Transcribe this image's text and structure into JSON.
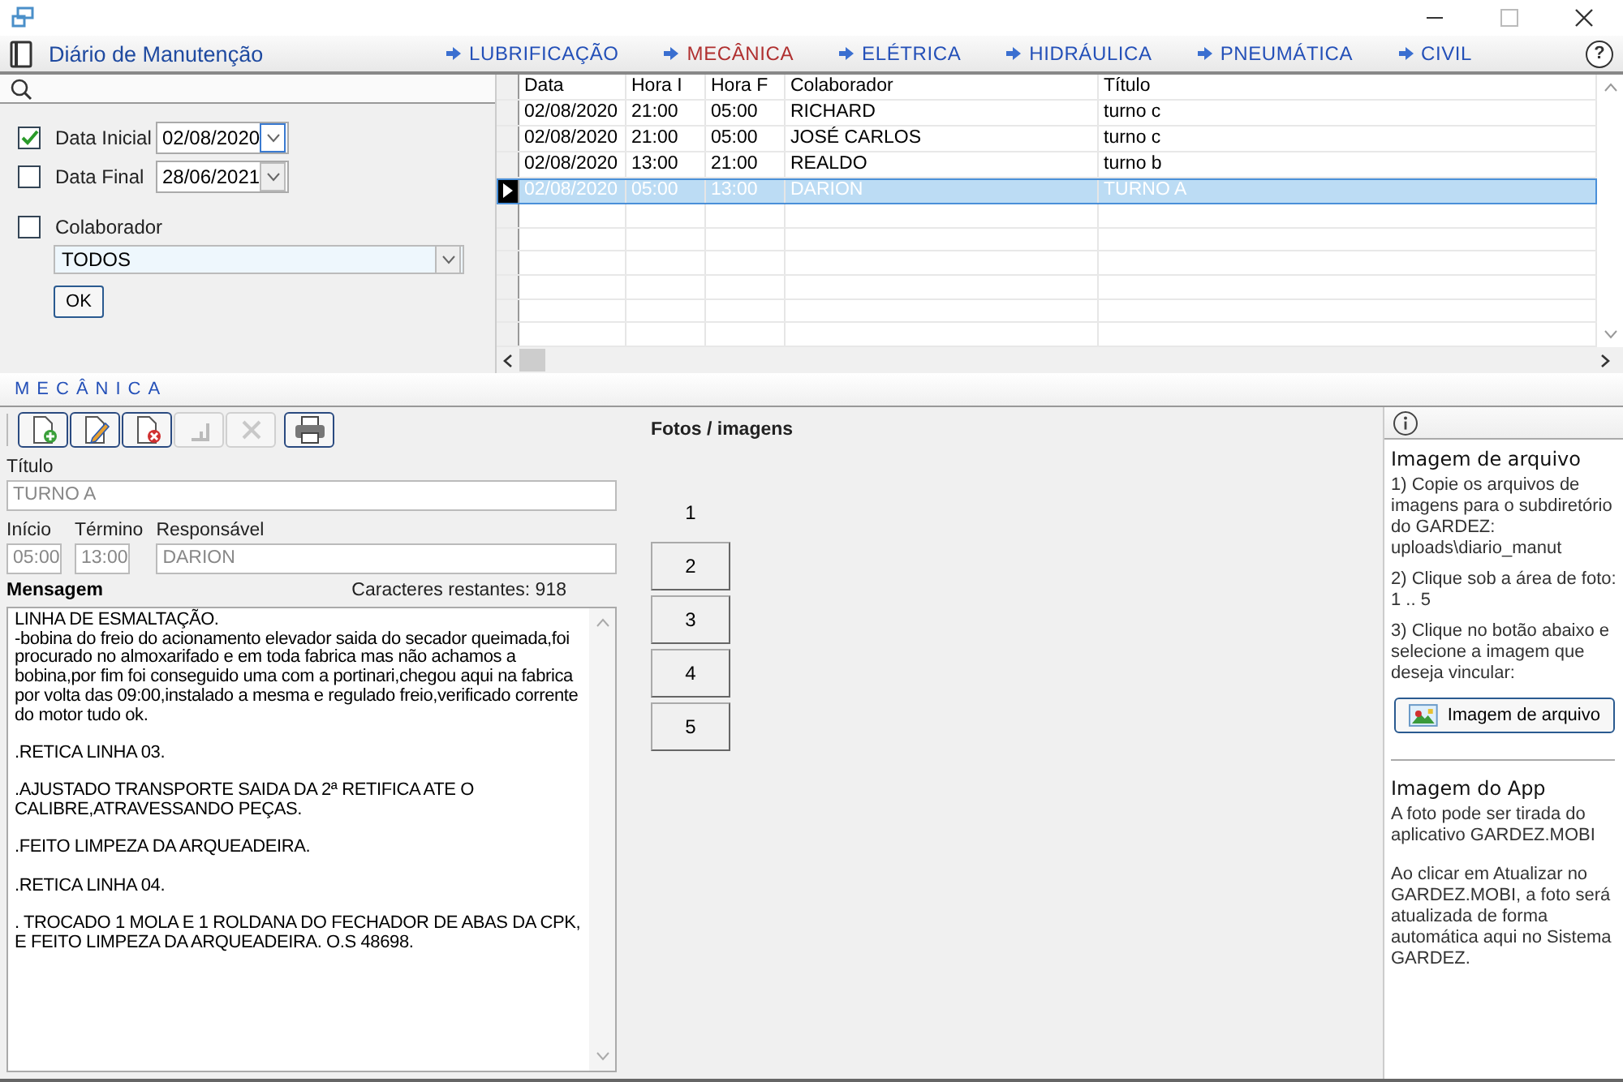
{
  "header": {
    "title": "Diário de Manutenção",
    "help": "?"
  },
  "nav": [
    {
      "label": "LUBRIFICAÇÃO",
      "selected": false
    },
    {
      "label": "MECÂNICA",
      "selected": true
    },
    {
      "label": "ELÉTRICA",
      "selected": false
    },
    {
      "label": "HIDRÁULICA",
      "selected": false
    },
    {
      "label": "PNEUMÁTICA",
      "selected": false
    },
    {
      "label": "CIVIL",
      "selected": false
    }
  ],
  "filters": {
    "start": {
      "label": "Data Inicial",
      "checked": true,
      "value": "02/08/2020"
    },
    "end": {
      "label": "Data Final",
      "checked": false,
      "value": "28/06/2021"
    },
    "collaborator": {
      "label": "Colaborador",
      "checked": false,
      "value": "TODOS"
    },
    "ok": "OK"
  },
  "table": {
    "columns": [
      "Data",
      "Hora I",
      "Hora F",
      "Colaborador",
      "Título"
    ],
    "rows": [
      {
        "cells": [
          "02/08/2020",
          "21:00",
          "05:00",
          "RICHARD",
          "turno c"
        ],
        "selected": false
      },
      {
        "cells": [
          "02/08/2020",
          "21:00",
          "05:00",
          "JOSÉ CARLOS",
          "turno c"
        ],
        "selected": false
      },
      {
        "cells": [
          "02/08/2020",
          "13:00",
          "21:00",
          "REALDO",
          "turno b"
        ],
        "selected": false
      },
      {
        "cells": [
          "02/08/2020",
          "05:00",
          "13:00",
          "DARION",
          "TURNO A"
        ],
        "selected": true
      }
    ]
  },
  "section": "MECÂNICA",
  "toolbar": [
    {
      "kind": "new",
      "disabled": false
    },
    {
      "kind": "edit",
      "disabled": false
    },
    {
      "kind": "delete",
      "disabled": false
    },
    {
      "kind": "save",
      "disabled": true
    },
    {
      "kind": "cancel",
      "disabled": true
    },
    {
      "kind": "print",
      "disabled": false
    }
  ],
  "form": {
    "title_label": "Título",
    "title": "TURNO A",
    "start_label": "Início",
    "start": "05:00",
    "end_label": "Término",
    "end": "13:00",
    "owner_label": "Responsável",
    "owner": "DARION",
    "message_label": "Mensagem",
    "remaining": "Caracteres restantes: 918",
    "message": "LINHA DE ESMALTAÇÃO.\n-bobina do freio do acionamento elevador saida do secador queimada,foi procurado no almoxarifado e em toda fabrica mas não achamos a bobina,por fim foi conseguido uma com a portinari,chegou aqui na fabrica por volta das 09:00,instalado a mesma e regulado freio,verificado corrente do motor tudo ok.\n\n.RETICA LINHA 03.\n\n.AJUSTADO TRANSPORTE SAIDA DA 2ª RETIFICA ATE O CALIBRE,ATRAVESSANDO PEÇAS.\n\n.FEITO LIMPEZA DA ARQUEADEIRA.\n\n.RETICA LINHA 04.\n\n. TROCADO 1 MOLA E 1 ROLDANA DO FECHADOR DE ABAS DA CPK, E FEITO LIMPEZA DA ARQUEADEIRA. O.S 48698."
  },
  "photos": {
    "title": "Fotos / imagens",
    "slots": [
      {
        "label": "1",
        "selected": true
      },
      {
        "label": "2",
        "selected": false
      },
      {
        "label": "3",
        "selected": false
      },
      {
        "label": "4",
        "selected": false
      },
      {
        "label": "5",
        "selected": false
      }
    ]
  },
  "info": {
    "file_heading": "Imagem de arquivo",
    "file_steps": [
      "1) Copie os arquivos de imagens para o subdiretório do GARDEZ: uploads\\diario_manut",
      "2) Clique sob a área de foto: 1 .. 5",
      "3) Clique no botão abaixo e selecione a imagem que deseja vincular:"
    ],
    "file_button": "Imagem de arquivo",
    "app_heading": "Imagem do App",
    "app_texts": [
      "A foto pode ser tirada do aplicativo GARDEZ.MOBI",
      "Ao clicar em Atualizar no GARDEZ.MOBI, a foto será atualizada de forma automática aqui no Sistema GARDEZ."
    ]
  }
}
